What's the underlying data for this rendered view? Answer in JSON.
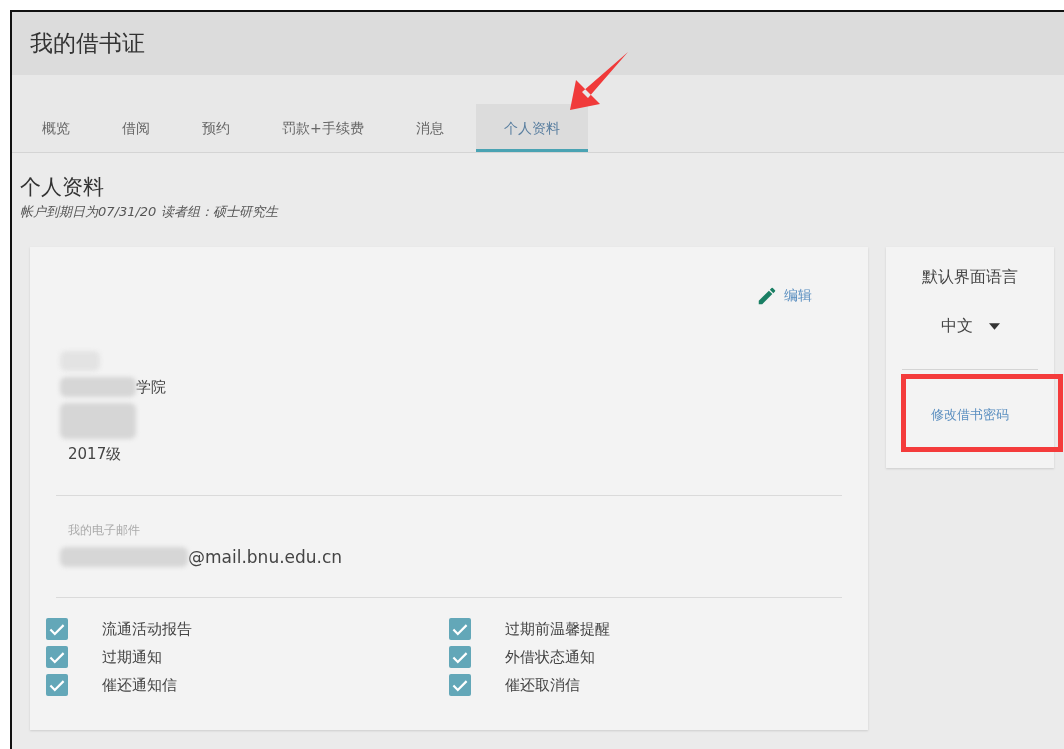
{
  "window": {
    "title": "我的借书证"
  },
  "tabs": [
    {
      "label": "概览",
      "selected": false
    },
    {
      "label": "借阅",
      "selected": false
    },
    {
      "label": "预约",
      "selected": false
    },
    {
      "label": "罚款+手续费",
      "selected": false
    },
    {
      "label": "消息",
      "selected": false
    },
    {
      "label": "个人资料",
      "selected": true
    }
  ],
  "page": {
    "heading": "个人资料",
    "subtitle": "帐户到期日为07/31/20 读者组：硕士研究生"
  },
  "profile": {
    "edit_label": "编辑",
    "college": "学院",
    "grade": "2017级",
    "email_label": "我的电子邮件",
    "email": "@mail.bnu.edu.cn"
  },
  "notifications": [
    {
      "label": "流通活动报告",
      "checked": true
    },
    {
      "label": "过期前温馨提醒",
      "checked": true
    },
    {
      "label": "过期通知",
      "checked": true
    },
    {
      "label": "外借状态通知",
      "checked": true
    },
    {
      "label": "催还通知信",
      "checked": true
    },
    {
      "label": "催还取消信",
      "checked": true
    }
  ],
  "sidebar": {
    "language_label": "默认界面语言",
    "language": "中文",
    "password_link": "修改借书密码"
  }
}
